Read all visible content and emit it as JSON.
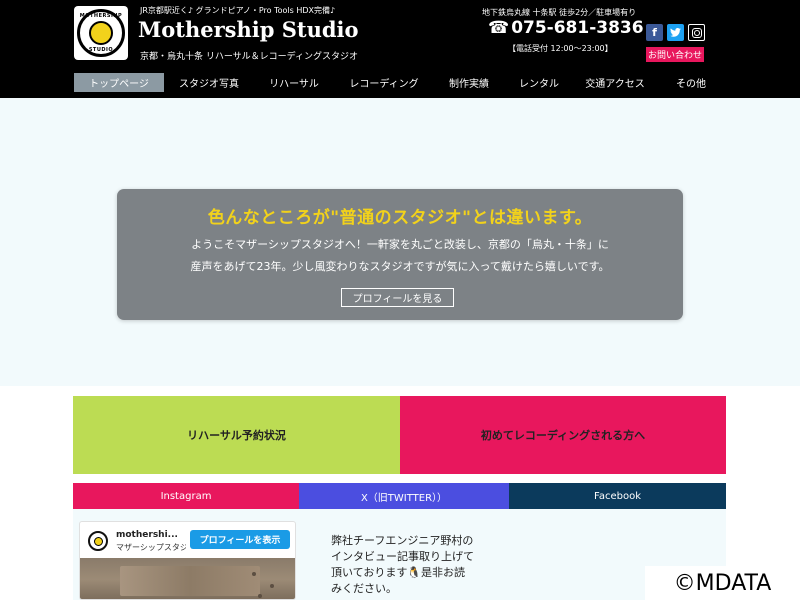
{
  "header": {
    "tagline": "JR京都駅近く♪ グランドピアノ・Pro Tools HDX完備♪",
    "title": "Mothership Studio",
    "subtitle": "京都・烏丸十条 リハーサル＆レコーディングスタジオ",
    "logo_text_top": "MOTHERSHIP",
    "logo_text_bottom": "STUDIO",
    "access": "地下鉄烏丸線 十条駅 徒歩2分／駐車場有り",
    "phone_icon": "☎",
    "phone": "075-681-3836",
    "hours": "【電話受付 12:00～23:00】",
    "contact_label": "お問い合わせ",
    "social": [
      "facebook-icon",
      "twitter-icon",
      "instagram-icon"
    ]
  },
  "nav": {
    "items": [
      {
        "label": "トップページ",
        "active": true
      },
      {
        "label": "スタジオ写真",
        "active": false
      },
      {
        "label": "リハーサル",
        "active": false
      },
      {
        "label": "レコーディング",
        "active": false
      },
      {
        "label": "制作実績",
        "active": false
      },
      {
        "label": "レンタル",
        "active": false
      },
      {
        "label": "交通アクセス",
        "active": false
      },
      {
        "label": "その他",
        "active": false
      }
    ]
  },
  "hero": {
    "title": "色んなところが\"普通のスタジオ\"とは違います。",
    "text_line1": "ようこそマザーシップスタジオへ！一軒家を丸ごと改装し、京都の「烏丸・十条」に",
    "text_line2": "産声をあげて23年。少し風変わりなスタジオですが気に入って戴けたら嬉しいです。",
    "button_label": "プロフィールを見る"
  },
  "banners": {
    "rehearsal": "リハーサル予約状況",
    "recording": "初めてレコーディングされる方へ"
  },
  "sns_tabs": {
    "instagram": "Instagram",
    "x": "X（旧TWITTER））",
    "facebook": "Facebook"
  },
  "instagram_embed": {
    "username": "mothershi...",
    "display_name": "マザーシップスタジ",
    "follow_label": "プロフィールを表示"
  },
  "interview": {
    "line1": "弊社チーフエンジニア野村の",
    "line2": "インタビュー記事取り上げて",
    "line3": "頂いております🐧是非お読",
    "line4": "みください。"
  },
  "watermark": "©MDATA",
  "colors": {
    "header_bg": "#000000",
    "accent_pink": "#e8175d",
    "accent_lime": "#bcdc53",
    "accent_yellow": "#f2d21b",
    "x_blue": "#4b4ee0",
    "fb_navy": "#0b3a5c",
    "hero_bg": "#f2fafc"
  }
}
